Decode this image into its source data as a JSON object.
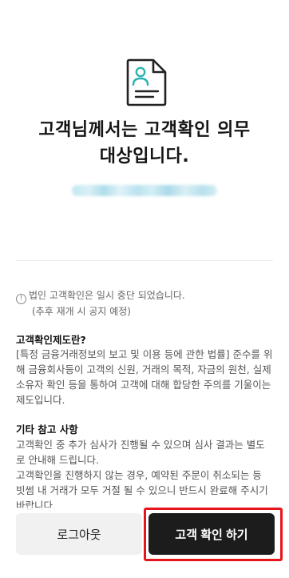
{
  "headline": {
    "line1": "고객님께서는 고객확인 의무",
    "line2": "대상입니다."
  },
  "masked_email": "",
  "notice": {
    "line1": "법인 고객확인은 일시 중단 되었습니다.",
    "line2": "(추후 재개 시 공지 예정)"
  },
  "sections": [
    {
      "title": "고객확인제도란?",
      "body": "[특정 금융거래정보의 보고 및 이용 등에 관한 법률] 준수를 위해 금융회사등이 고객의 신원, 거래의 목적, 자금의 원천, 실제 소유자 확인 등을 통하여 고객에 대해 합당한 주의를 기울이는 제도입니다."
    },
    {
      "title": "기타 참고 사항",
      "body1": "고객확인 중 추가 심사가 진행될 수 있으며 심사 결과는 별도로 안내해 드립니다.",
      "body2": "고객확인을 진행하지 않는 경우, 예약된 주문이 취소되는 등 빗썸 내 거래가 모두 거절 될 수 있으니 반드시 완료해 주시기 바랍니다."
    }
  ],
  "buttons": {
    "logout": "로그아웃",
    "verify": "고객 확인 하기"
  },
  "colors": {
    "accent_teal": "#2bb3b0",
    "highlight_red": "#e8141c",
    "primary_button": "#1c1c1c"
  }
}
